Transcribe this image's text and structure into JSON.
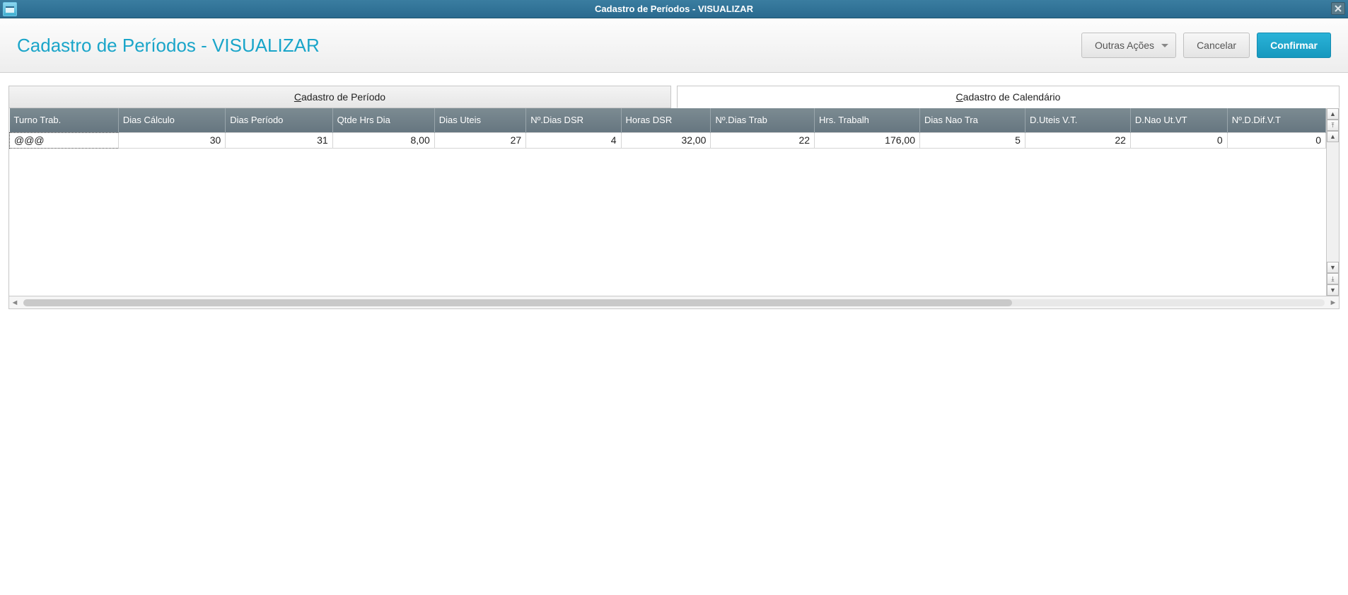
{
  "window": {
    "title": "Cadastro de Períodos - VISUALIZAR"
  },
  "header": {
    "page_title": "Cadastro de Períodos - VISUALIZAR",
    "other_actions_label": "Outras Ações",
    "cancel_label": "Cancelar",
    "confirm_label": "Confirmar"
  },
  "tabs": {
    "period_prefix": "C",
    "period_rest": "adastro de Período",
    "calendar_prefix": "C",
    "calendar_rest": "adastro de Calendário"
  },
  "grid": {
    "columns": [
      "Turno Trab.",
      "Dias Cálculo",
      "Dias Período",
      "Qtde Hrs Dia",
      "Dias Uteis",
      "Nº.Dias DSR",
      "Horas DSR",
      "Nº.Dias Trab",
      "Hrs. Trabalh",
      "Dias Nao Tra",
      "D.Uteis V.T.",
      "D.Nao Ut.VT",
      "Nº.D.Dif.V.T"
    ],
    "rows": [
      {
        "c0": "@@@",
        "c1": "30",
        "c2": "31",
        "c3": "8,00",
        "c4": "27",
        "c5": "4",
        "c6": "32,00",
        "c7": "22",
        "c8": "176,00",
        "c9": "5",
        "c10": "22",
        "c11": "0",
        "c12": "0"
      }
    ]
  }
}
